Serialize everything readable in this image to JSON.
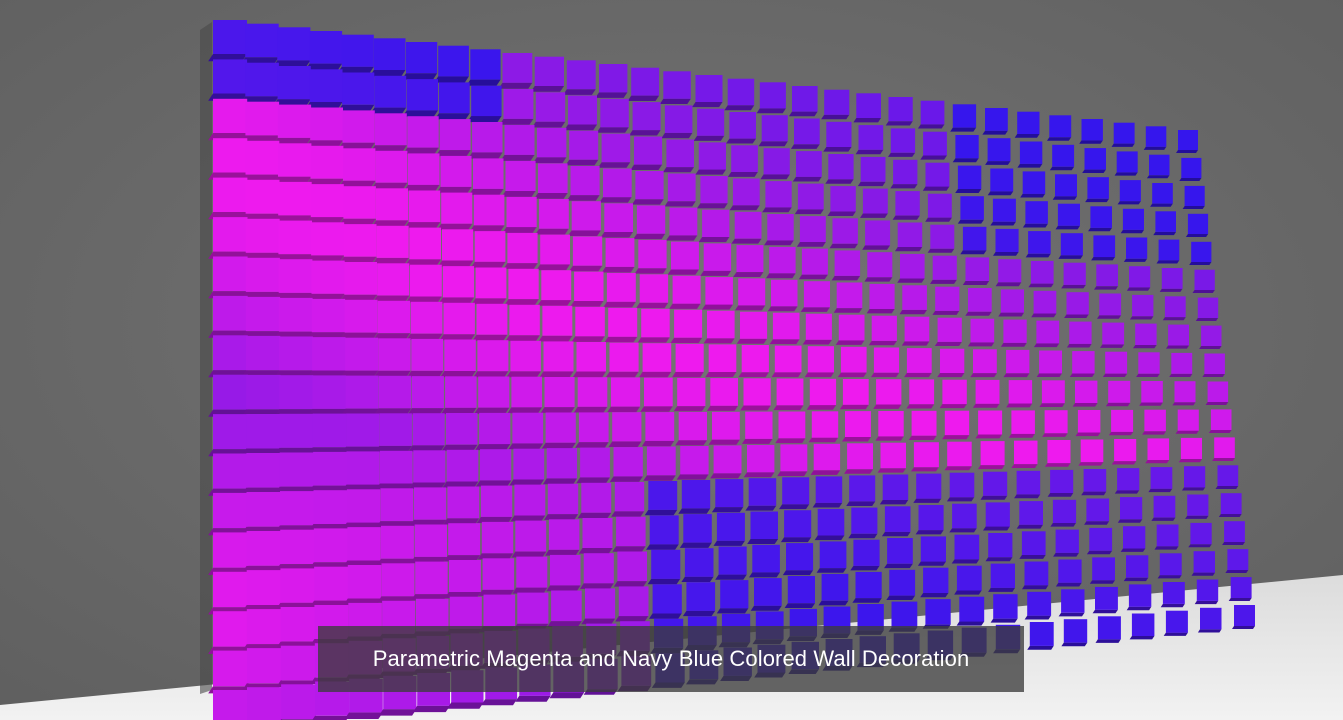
{
  "caption": {
    "text": "Parametric Magenta and Navy Blue Colored Wall Decoration"
  },
  "scene": {
    "subject": "parametric cube wall decoration",
    "colors": {
      "wall": "#6b6b6b",
      "floor": "#e9e9e9",
      "magenta": "#ee1aee",
      "purple": "#8a1ae6",
      "navy_blue": "#1414f0",
      "caption_background": "#3c3c3c"
    }
  }
}
